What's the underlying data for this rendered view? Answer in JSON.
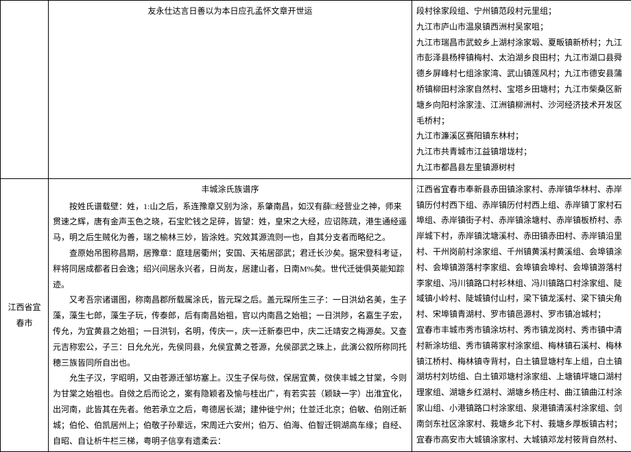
{
  "row1": {
    "mid_title": "友永仕达言日善以为本日应孔孟怀文章开世运",
    "right_lines": [
      "段村徐家段组、宁州镇范段村元里组；",
      "九江市庐山市温泉镇西洲村吴家咀；",
      "九江市瑞昌市武蛟乡上湖村涂家塅、夏畈镇新桥村；九江市彭泽县杨梓镇梅村、太泊湖乡良田村；九江市湖口县舜德乡屏峰村七组涂家湾、武山镇莲风村；九江市德安县蒲桥镇柳田村涂家自然村、宝塔乡田塘村；九江市柴桑区新塘乡向阳村涂家洼、江洲镇柳洲村、沙河经济技术开发区毛桥村；",
      "九江市濂溪区赛阳镇东林村；",
      "九江市共青城市江益镇增垅村；",
      "九江市都昌县左里镇源树村"
    ]
  },
  "row2": {
    "left": "江西省宜春市",
    "mid_title": "丰城涂氏族谱序",
    "mid_paragraphs": [
      "按姓氏谱载壁：姓，1:山之后，系连豫章又别为涂，系肇南昌，如汉有薛□经营业之神，师来贯速之辉，唐有金声玉色之晓，石宝贮钱之足碎，皆望：姓，皇宋之大经，应诏陈疏，港生通经遥马，明之后生贼化为善，瑞之榆林三妙，皆涂姓。究效其源流则一也，自其分支者而略纪之。",
      "查原始吊图称昌期，居豫章：庭珪居衢州；安国、天祐居邵武；君迁长沙矣。据宋登科考证，秤将同居成都者日会逸；绍兴间居永兴者，日尚友，居建山者，日南M%矣。世代迁徙俱英能知踪迹。",
      "又考吾宗诸谱图，称南昌郡所载属涂氏，皆元琛之后。盖元琛所生三子：一日洪幼名美，生子藻，藻生七郎，藻生子玩，传泰郎，后有南昌始祖，官以内南昌之始祖；一日洪陟，名嘉生子宏，传允，为宜黄县之始祖；一日洪钊，名明，传庆一，庆一迁新泰巴中，庆二迁靖安之梅源矣。又查元吉称宏公，子三：日允允光，先侯同县，允侯宜黄之苍源，允侯邵武之珠上，此演公叙所称同托穂三族皆同所自出也。",
      "允生子汉，字昭明，又由苍源迁邹坊塞上。汉生子保与傚，保居宜黄，傚侠丰城之甘棠，今则为甘棠之始祖也。自傚之后而论之，案有隐颖者及愉与桂出广，有若实芸（颖缺一字）出淮宜化，出河南，此皆其在先者。他若承立之后，粤德居长湖；建仲徙宁州；仕並迁北京；伯敏、伯刚迁新城；伯伦、伯凯居州上；伯敬子孙辈远，宋周迁六安州；伯万、伯海、伯智迁铜湖高车缘；自经、自昭、自让析牛栏三梯，粤明子信享有遗柔云："
    ],
    "right_lines": [
      "江西省宜春市奉新县赤田镇涂家村、赤岸镇华林村、赤岸镇历付村西下组、赤岸镇历付村西上组、赤岸镇丁家村石埠组、赤岸镇街子村、赤岸镇涂塘村、赤岸镇板桥村、赤岸城下村，赤岸镇沈塘溪村、赤田镇赤田村、赤岸镇沿里村、干州岗前村涂家组、千州镇黄溪村黄溪组、会埠镇涂村、会埠镇游落村李家组、会埠镇会埠村、会埠镇游落村李家组、冯川镇路口村衫林组、冯川镇路口村涂家组、陡域镇小岭村、陡城镇付山村，梁下镇龙溪村、梁下镇尖角村、宋埠镇青湖村、罗市镇邑源村、罗市镇冶城村；",
      "宜春市丰城市秀市镇涂坊村、秀市镇龙岗村、秀市镇中清村新涂坊组、秀市镇蒋家村涂家组、梅林镇石溪村、梅林镇江桥村、梅林镇寺背村，白土镇显塘村车上组，白土镇湖坊村刘坊组、白土镇邓塘村涂家组、上塘镇坪塘口湖村理家组、湖塘乡红湖村、湖塘乡杨庄村、曲江镇曲江村涂家山组、小港镇路口村涂家组、泉港镇清溪村涂家组、剑南剑东社区涂家村、莪塘乡北下村、莪塘乡厚板镇古村；",
      "宜春市高安市大城镇涂家村、大城镇邓龙村筱背自然村、"
    ]
  }
}
